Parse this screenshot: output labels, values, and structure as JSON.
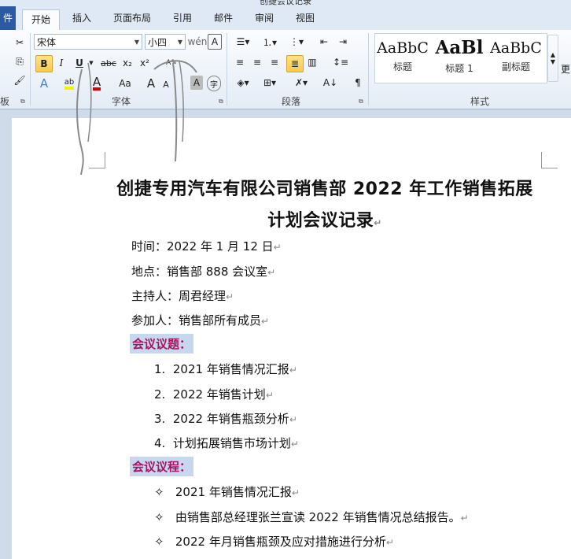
{
  "window": {
    "title": "创捷会议记录"
  },
  "tabs": {
    "file": "件",
    "home": "开始",
    "insert": "插入",
    "layout": "页面布局",
    "references": "引用",
    "mailings": "邮件",
    "review": "审阅",
    "view": "视图"
  },
  "font": {
    "name": "宋体",
    "size": "小四",
    "group_label": "字体"
  },
  "paragraph": {
    "group_label": "段落"
  },
  "clipboard": {
    "group_label": "板"
  },
  "styles": {
    "group_label": "样式",
    "items": [
      {
        "preview": "AaBbC",
        "label": "标题"
      },
      {
        "preview": "AaBl",
        "label": "标题 1"
      },
      {
        "preview": "AaBbC",
        "label": "副标题"
      }
    ],
    "more_label": "更"
  },
  "buttons": {
    "bold": "B",
    "italic": "I",
    "underline": "U",
    "strike": "abc",
    "sub": "x₂",
    "sup": "x²",
    "grow": "A",
    "shrink": "A",
    "case": "Aa",
    "clear": "A"
  },
  "document": {
    "title_line1": "创捷专用汽车有限公司销售部 2022 年工作销售拓展",
    "title_line2": "计划会议记录",
    "info": [
      "时间：2022 年 1 月 12 日",
      "地点：销售部 888 会议室",
      "主持人：周君经理",
      "参加人：销售部所有成员"
    ],
    "topics_heading": "会议议题：",
    "topics": [
      {
        "n": "1.",
        "text": "2021 年销售情况汇报"
      },
      {
        "n": "2.",
        "text": "2022 年销售计划"
      },
      {
        "n": "3.",
        "text": "2022 年销售瓶颈分析"
      },
      {
        "n": "4.",
        "text": "计划拓展销售市场计划"
      }
    ],
    "process_heading": "会议议程：",
    "process": [
      "2021 年销售情况汇报",
      "由销售部总经理张兰宣读 2022 年销售情况总结报告。",
      "2022 年月销售瓶颈及应对措施进行分析"
    ],
    "para_mark": "↵",
    "bullet_symbol": "✧"
  }
}
